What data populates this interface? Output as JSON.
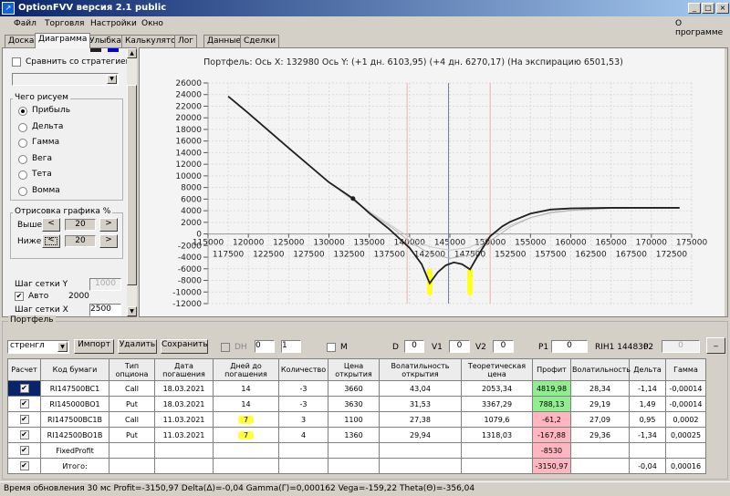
{
  "window": {
    "title": "OptionFVV версия 2.1 public",
    "icon": "app-chart-icon",
    "controls": [
      "_",
      "□",
      "×"
    ]
  },
  "menu": {
    "items": [
      "Файл",
      "Торговля",
      "Настройки",
      "Окно"
    ],
    "about": "О программе"
  },
  "tabs": [
    "Доска",
    "Диаграмма",
    "Улыбка",
    "Калькулятор",
    "Лог",
    "Данные",
    "Сделки"
  ],
  "active_tab": "Диаграмма",
  "left": {
    "swatch_colors": [
      "#202020",
      "#0000e0"
    ],
    "compare_label": "Сравнить со стратегией",
    "compare_checked": false,
    "draw_group": "Чего рисуем",
    "draw_options": [
      "Прибыль",
      "Дельта",
      "Гамма",
      "Вега",
      "Тета",
      "Вомма"
    ],
    "draw_selected": "Прибыль",
    "range_group": "Отрисовка графика %",
    "above_label": "Выше",
    "above_value": "20",
    "below_label": "Ниже",
    "below_value": "20",
    "prev": "<",
    "next": ">",
    "grid_y_label": "Шаг сетки Y",
    "grid_y_value": "1000",
    "auto_label": "Авто",
    "auto_checked": true,
    "auto_value": "2000",
    "grid_x_label": "Шаг сетки X",
    "grid_x_value": "2500"
  },
  "chart_header": "Портфель: Ось X: 132980 Ось Y:  (+1 дн. 6103,95)  (+4 дн. 6270,17)  (На экспирацию 6501,53)",
  "chart_data": {
    "type": "line",
    "xlim": [
      115000,
      175000
    ],
    "ylim": [
      -12000,
      26000
    ],
    "grid": true,
    "y_ticks": [
      26000,
      24000,
      22000,
      20000,
      18000,
      16000,
      14000,
      12000,
      10000,
      8000,
      6000,
      4000,
      2000,
      0,
      -2000,
      -4000,
      -6000,
      -8000,
      -10000,
      -12000
    ],
    "x_ticks_major": [
      115000,
      120000,
      125000,
      130000,
      135000,
      140000,
      145000,
      150000,
      155000,
      160000,
      165000,
      170000,
      175000
    ],
    "x_ticks_minor": [
      117500,
      122500,
      127500,
      132500,
      137500,
      142500,
      147500,
      152500,
      157500,
      162500,
      167500,
      172500
    ],
    "vertical_lines": [
      {
        "x": 139700,
        "color": "#f0b0b0"
      },
      {
        "x": 144830,
        "color": "#7080a0"
      },
      {
        "x": 150000,
        "color": "#f0b0b0"
      }
    ],
    "cursor_point": {
      "x": 132980,
      "y": 6100
    },
    "highlights": [
      142500,
      147500
    ],
    "series": [
      {
        "color": "#c8c8c8",
        "points": [
          [
            117500,
            23700
          ],
          [
            125000,
            14800
          ],
          [
            130000,
            8900
          ],
          [
            135000,
            3900
          ],
          [
            138000,
            1200
          ],
          [
            140000,
            -600
          ],
          [
            142500,
            -2200
          ],
          [
            145000,
            -2800
          ],
          [
            147500,
            -2300
          ],
          [
            150000,
            -400
          ],
          [
            152500,
            1500
          ],
          [
            155000,
            2800
          ],
          [
            157500,
            3600
          ],
          [
            160000,
            4000
          ],
          [
            165000,
            4400
          ],
          [
            173500,
            4500
          ]
        ]
      },
      {
        "color": "#b4b4b4",
        "points": [
          [
            117500,
            23700
          ],
          [
            125000,
            14800
          ],
          [
            130000,
            8900
          ],
          [
            135000,
            3700
          ],
          [
            138000,
            900
          ],
          [
            140000,
            -1300
          ],
          [
            142500,
            -3400
          ],
          [
            145000,
            -4200
          ],
          [
            147500,
            -3600
          ],
          [
            150000,
            -1200
          ],
          [
            152500,
            1200
          ],
          [
            155000,
            2800
          ],
          [
            157500,
            3700
          ],
          [
            160000,
            4100
          ],
          [
            165000,
            4450
          ],
          [
            173500,
            4500
          ]
        ]
      },
      {
        "color": "#202020",
        "points": [
          [
            117500,
            23700
          ],
          [
            120000,
            20800
          ],
          [
            125000,
            14800
          ],
          [
            130000,
            8900
          ],
          [
            132980,
            6100
          ],
          [
            135000,
            3600
          ],
          [
            137500,
            800
          ],
          [
            140000,
            -2400
          ],
          [
            141500,
            -5200
          ],
          [
            142500,
            -8500
          ],
          [
            143500,
            -6600
          ],
          [
            144500,
            -5400
          ],
          [
            145500,
            -4900
          ],
          [
            146500,
            -5200
          ],
          [
            147500,
            -6100
          ],
          [
            148500,
            -3700
          ],
          [
            150000,
            -400
          ],
          [
            151500,
            1300
          ],
          [
            152500,
            2100
          ],
          [
            155000,
            3500
          ],
          [
            157500,
            4200
          ],
          [
            160000,
            4400
          ],
          [
            165000,
            4500
          ],
          [
            173500,
            4500
          ]
        ]
      }
    ]
  },
  "portfolio": {
    "title": "Портфель",
    "strategy": "стренгл",
    "import": "Импорт",
    "delete": "Удалить",
    "save": "Сохранить",
    "dh_label": "DH",
    "spin1": "0",
    "spin2": "1",
    "m_label": "M",
    "d_label": "D",
    "d_value": "0",
    "v1_label": "V1",
    "v1_value": "0",
    "v2_label": "V2",
    "v2_value": "0",
    "p1_label": "P1",
    "p1_value": "0",
    "underlying": "RIH1 144830",
    "p2_label": "P2",
    "p2_value": "0",
    "min_btn": "_",
    "columns": [
      "Расчет",
      "Код бумаги",
      "Тип опциона",
      "Дата погашения",
      "Дней до погашения",
      "Количество",
      "Цена открытия",
      "Волатильность открытия",
      "Теоретическая цена",
      "Профит",
      "Волатильность",
      "Дельта",
      "Гамма"
    ],
    "rows": [
      {
        "code": "RI147500BC1",
        "type": "Call",
        "date": "18.03.2021",
        "days": "14",
        "qty": "-3",
        "price": "3660",
        "vol_open": "43,04",
        "theo": "2053,34",
        "profit": "4819,98",
        "vol": "28,34",
        "delta": "-1,14",
        "gamma": "-0,00014",
        "profit_color": "green",
        "hl": false
      },
      {
        "code": "RI145000BO1",
        "type": "Put",
        "date": "18.03.2021",
        "days": "14",
        "qty": "-3",
        "price": "3630",
        "vol_open": "31,53",
        "theo": "3367,29",
        "profit": "788,13",
        "vol": "29,19",
        "delta": "1,49",
        "gamma": "-0,00014",
        "profit_color": "green",
        "hl": false
      },
      {
        "code": "RI147500BC1B",
        "type": "Call",
        "date": "11.03.2021",
        "days": "7",
        "qty": "3",
        "price": "1100",
        "vol_open": "27,38",
        "theo": "1079,6",
        "profit": "-61,2",
        "vol": "27,09",
        "delta": "0,95",
        "gamma": "0,0002",
        "profit_color": "pink",
        "hl": true
      },
      {
        "code": "RI142500BO1B",
        "type": "Put",
        "date": "11.03.2021",
        "days": "7",
        "qty": "4",
        "price": "1360",
        "vol_open": "29,94",
        "theo": "1318,03",
        "profit": "-167,88",
        "vol": "29,36",
        "delta": "-1,34",
        "gamma": "0,00025",
        "profit_color": "pink",
        "hl": true
      },
      {
        "code": "FixedProfit",
        "type": "",
        "date": "",
        "days": "",
        "qty": "",
        "price": "",
        "vol_open": "",
        "theo": "",
        "profit": "-8530",
        "vol": "",
        "delta": "",
        "gamma": "",
        "profit_color": "pink",
        "hl": false
      },
      {
        "code": "Итого:",
        "type": "",
        "date": "",
        "days": "",
        "qty": "",
        "price": "",
        "vol_open": "",
        "theo": "",
        "profit": "-3150,97",
        "vol": "",
        "delta": "-0,04",
        "gamma": "0,00016",
        "profit_color": "pink",
        "hl": false
      }
    ]
  },
  "status": "Время обновления 30 мс  Profit=-3150,97 Delta(Δ)=-0,04 Gamma(Γ)=0,000162 Vega=-159,22 Theta(Θ)=-356,04"
}
